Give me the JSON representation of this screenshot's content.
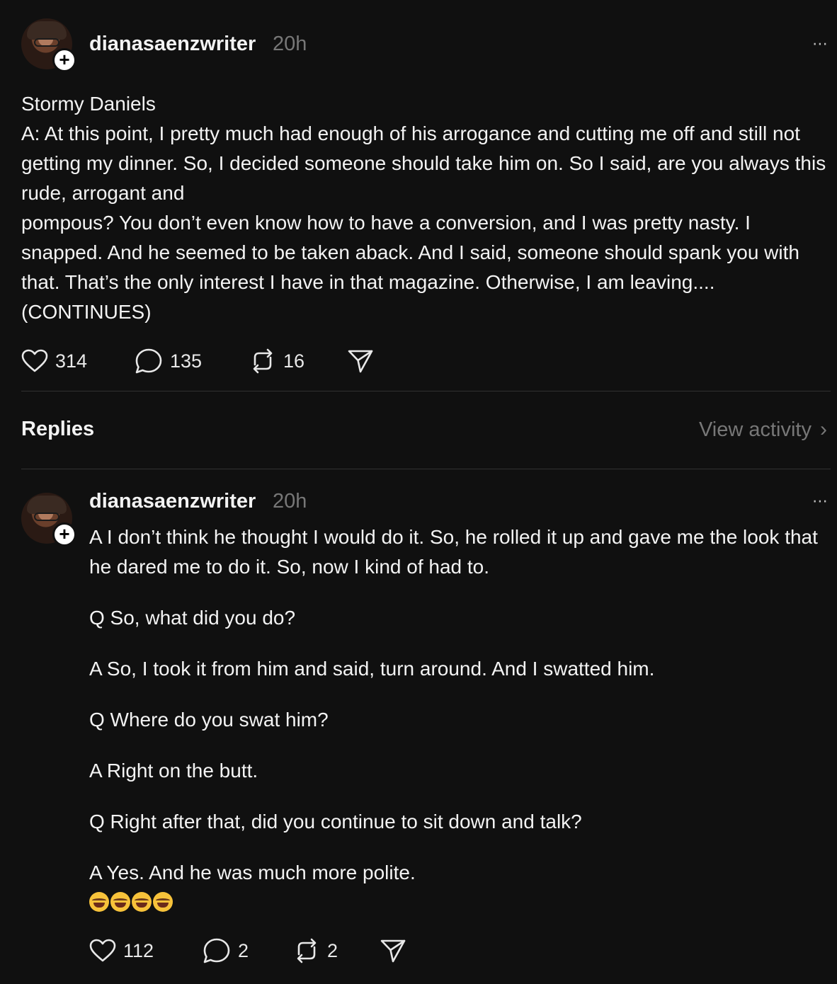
{
  "post": {
    "username": "dianasaenzwriter",
    "time": "20h",
    "more_icon": "⋯",
    "avatar_badge": "+",
    "body_lines": [
      "Stormy Daniels",
      "A: At this point, I pretty much had enough of his arrogance and cutting me off and still not getting my dinner. So, I decided someone should take him on. So I said, are you always this rude, arrogant and",
      "pompous? You don’t even know how to have a conversion, and I was pretty nasty. I snapped. And he seemed to be taken aback. And I said, someone should spank you with that. That’s the only interest I have in that magazine. Otherwise, I am leaving.... (CONTINUES)"
    ],
    "likes": "314",
    "comments": "135",
    "reposts": "16"
  },
  "replies_section": {
    "title": "Replies",
    "view_activity": "View activity",
    "chevron": "›"
  },
  "reply": {
    "username": "dianasaenzwriter",
    "time": "20h",
    "more_icon": "⋯",
    "avatar_badge": "+",
    "paragraphs": [
      "A I don’t think he thought I would do it. So, he rolled it up and gave me the look that he dared me to do it. So, now I kind of had to.",
      "Q So, what did you do?",
      "A So, I took it from him and said, turn around. And I swatted him.",
      "Q Where do you swat him?",
      "A Right on the butt.",
      "Q Right after that, did you continue to sit down and talk?",
      "A Yes. And he was much more polite."
    ],
    "emojis": [
      "😂",
      "🤣",
      "😂",
      "🤣"
    ],
    "likes": "112",
    "comments": "2",
    "reposts": "2"
  },
  "icons": {
    "like": "heart-icon",
    "comment": "comment-bubble-icon",
    "repost": "repost-icon",
    "share": "send-icon"
  }
}
